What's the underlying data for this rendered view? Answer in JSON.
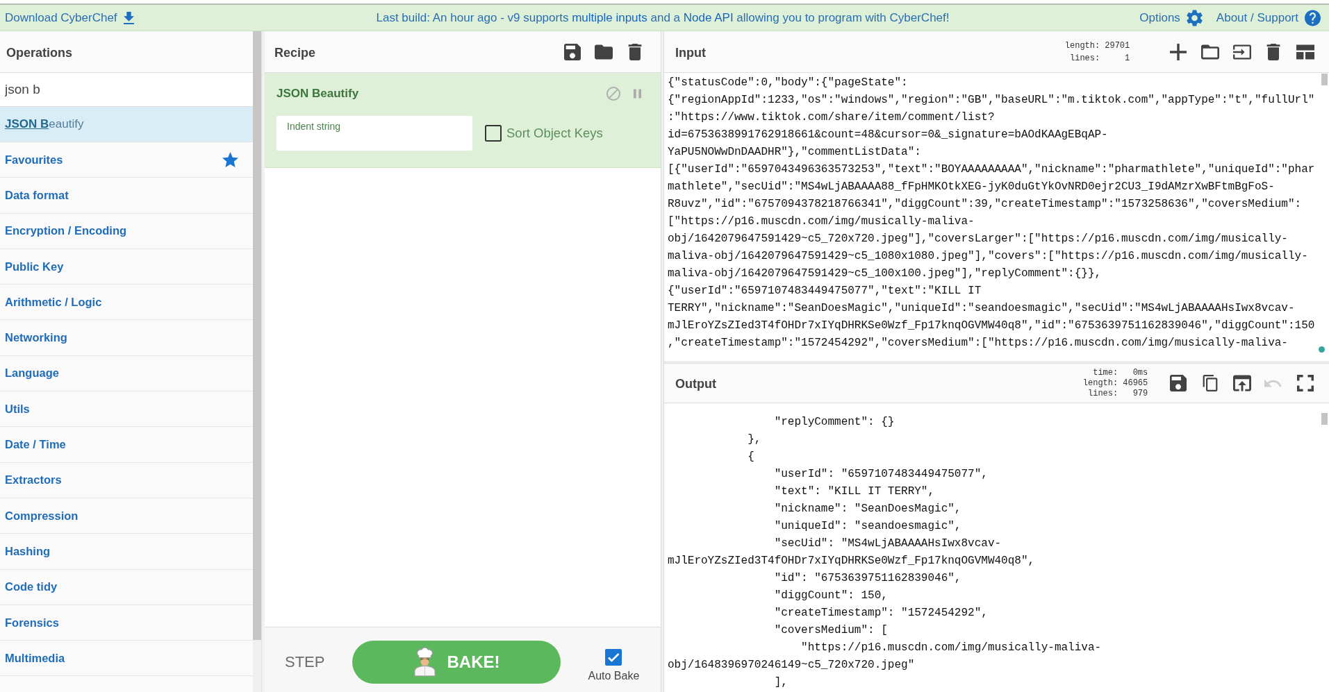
{
  "top_bar": {
    "download_link": "Download CyberChef",
    "notice": [
      {
        "text": "Last build: An hour ago - v9 supports ",
        "link": false
      },
      {
        "text": "multiple inputs",
        "link": true
      },
      {
        "text": " and a ",
        "link": false
      },
      {
        "text": "Node API",
        "link": true
      },
      {
        "text": " allowing you to program with CyberChef!",
        "link": false
      }
    ],
    "options_link": "Options",
    "support_link": "About / Support"
  },
  "operations": {
    "title": "Operations",
    "search": {
      "value": "json b"
    },
    "results": [
      {
        "label": "**JSON B**eautify",
        "selected": true
      }
    ],
    "categories": [
      {
        "label": "Favourites",
        "kind": "favourites"
      },
      {
        "label": "Data format",
        "kind": "category"
      },
      {
        "label": "Encryption / Encoding",
        "kind": "category"
      },
      {
        "label": "Public Key",
        "kind": "category"
      },
      {
        "label": "Arithmetic / Logic",
        "kind": "category"
      },
      {
        "label": "Networking",
        "kind": "category"
      },
      {
        "label": "Language",
        "kind": "category"
      },
      {
        "label": "Utils",
        "kind": "category"
      },
      {
        "label": "Date / Time",
        "kind": "category"
      },
      {
        "label": "Extractors",
        "kind": "category"
      },
      {
        "label": "Compression",
        "kind": "category"
      },
      {
        "label": "Hashing",
        "kind": "category"
      },
      {
        "label": "Code tidy",
        "kind": "category"
      },
      {
        "label": "Forensics",
        "kind": "category"
      },
      {
        "label": "Multimedia",
        "kind": "category"
      }
    ]
  },
  "recipe": {
    "title": "Recipe",
    "operations": [
      {
        "name": "JSON Beautify",
        "args": [
          {
            "kind": "text",
            "label": "Indent string"
          },
          {
            "kind": "checkbox",
            "label": "Sort Object Keys",
            "checked": false
          }
        ]
      }
    ],
    "step_button": "STEP",
    "bake_button": "BAKE!",
    "auto_bake": {
      "label": "Auto Bake",
      "checked": true
    }
  },
  "input": {
    "title": "Input",
    "stats": [
      {
        "label": "length:",
        "value": "29701"
      },
      {
        "label": "lines:",
        "value": "1"
      }
    ],
    "lines": [
      "{\"statusCode\":0,\"body\":{\"pageState\":",
      "{\"regionAppId\":1233,\"os\":\"windows\",\"region\":\"GB\",\"baseURL\":\"m.tiktok.com\",\"appType\":\"t\",\"fullUrl\"",
      ":\"https://www.tiktok.com/share/item/comment/list?",
      "id=6753638991762918661&count=48&cursor=0&_signature=bAOdKAAgEBqAP-",
      "YaPU5NOWwDnDAADHR\"},\"commentListData\":",
      "[{\"userId\":\"6597043496363573253\",\"text\":\"BOYAAAAAAAAA\",\"nickname\":\"pharmathlete\",\"uniqueId\":\"phar",
      "mathlete\",\"secUid\":\"MS4wLjABAAAA88_fFpHMKOtkXEG-jyK0duGtYkOvNRD0ejr2CU3_I9dAMzrXwBFtmBgFoS-",
      "R8uvz\",\"id\":\"6757094378218766341\",\"diggCount\":39,\"createTimestamp\":\"1573258636\",\"coversMedium\":",
      "[\"https://p16.muscdn.com/img/musically-maliva-",
      "obj/1642079647591429~c5_720x720.jpeg\"],\"coversLarger\":[\"https://p16.muscdn.com/img/musically-",
      "maliva-obj/1642079647591429~c5_1080x1080.jpeg\"],\"covers\":[\"https://p16.muscdn.com/img/musically-",
      "maliva-obj/1642079647591429~c5_100x100.jpeg\"],\"replyComment\":{}},",
      "{\"userId\":\"6597107483449475077\",\"text\":\"KILL IT",
      "TERRY\",\"nickname\":\"SeanDoesMagic\",\"uniqueId\":\"seandoesmagic\",\"secUid\":\"MS4wLjABAAAAHsIwx8vcav-",
      "mJlEroYZsZIed3T4fOHDr7xIYqDHRKSe0Wzf_Fp17knqOGVMW40q8\",\"id\":\"6753639751162839046\",\"diggCount\":150",
      ",\"createTimestamp\":\"1572454292\",\"coversMedium\":[\"https://p16.muscdn.com/img/musically-maliva-"
    ]
  },
  "output": {
    "title": "Output",
    "stats": [
      {
        "label": "time:",
        "value": "0ms"
      },
      {
        "label": "length:",
        "value": "46965"
      },
      {
        "label": "lines:",
        "value": "979"
      }
    ],
    "undo": {
      "disabled": true
    },
    "lines": [
      "                \"replyComment\": {}",
      "            },",
      "            {",
      "                \"userId\": \"6597107483449475077\",",
      "                \"text\": \"KILL IT TERRY\",",
      "                \"nickname\": \"SeanDoesMagic\",",
      "                \"uniqueId\": \"seandoesmagic\",",
      "                \"secUid\": \"MS4wLjABAAAAHsIwx8vcav-",
      "mJlEroYZsZIed3T4fOHDr7xIYqDHRKSe0Wzf_Fp17knqOGVMW40q8\",",
      "                \"id\": \"6753639751162839046\",",
      "                \"diggCount\": 150,",
      "                \"createTimestamp\": \"1572454292\",",
      "                \"coversMedium\": [",
      "                    \"https://p16.muscdn.com/img/musically-maliva-",
      "obj/1648396970246149~c5_720x720.jpeg\"",
      "                ],"
    ]
  }
}
